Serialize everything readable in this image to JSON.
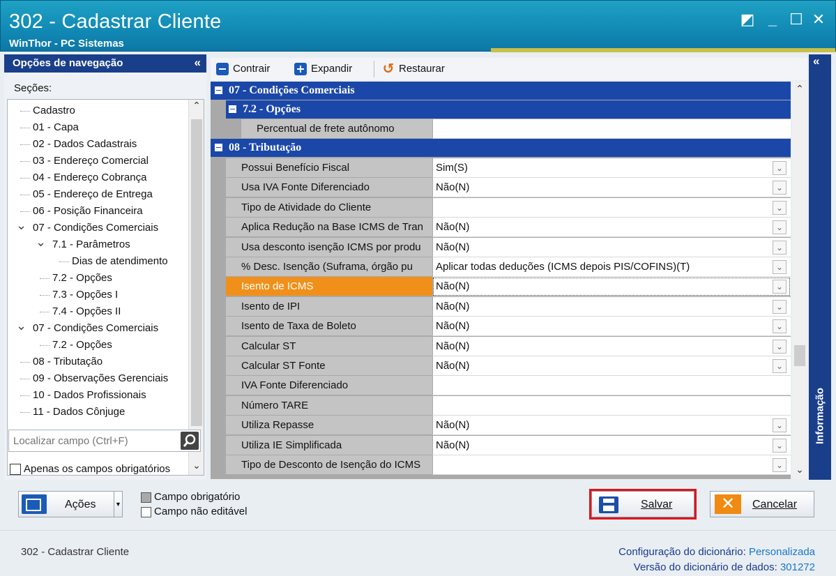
{
  "window": {
    "title": "302 - Cadastrar Cliente",
    "subtitle": "WinThor - PC Sistemas"
  },
  "nav": {
    "header": "Opções de navegação",
    "collapse": "«",
    "sections_label": "Seções:",
    "items": [
      {
        "label": "Cadastro",
        "level": 0,
        "expander": ""
      },
      {
        "label": "01 - Capa",
        "level": 0,
        "expander": ""
      },
      {
        "label": "02 - Dados Cadastrais",
        "level": 0,
        "expander": ""
      },
      {
        "label": "03 - Endereço Comercial",
        "level": 0,
        "expander": ""
      },
      {
        "label": "04 - Endereço Cobrança",
        "level": 0,
        "expander": ""
      },
      {
        "label": "05 - Endereço de Entrega",
        "level": 0,
        "expander": ""
      },
      {
        "label": "06 - Posição Financeira",
        "level": 0,
        "expander": ""
      },
      {
        "label": "07 - Condições Comerciais",
        "level": 0,
        "expander": "v"
      },
      {
        "label": "7.1 - Parâmetros",
        "level": 1,
        "expander": "v"
      },
      {
        "label": "Dias de atendimento",
        "level": 2,
        "expander": ""
      },
      {
        "label": "7.2 - Opções",
        "level": 1,
        "expander": ""
      },
      {
        "label": "7.3 - Opções I",
        "level": 1,
        "expander": ""
      },
      {
        "label": "7.4 - Opções II",
        "level": 1,
        "expander": ""
      },
      {
        "label": "07 - Condições Comerciais",
        "level": 0,
        "expander": "v"
      },
      {
        "label": "7.2 - Opções",
        "level": 1,
        "expander": ""
      },
      {
        "label": "08 - Tributação",
        "level": 0,
        "expander": ""
      },
      {
        "label": "09 - Observações Gerenciais",
        "level": 0,
        "expander": ""
      },
      {
        "label": "10 - Dados Profissionais",
        "level": 0,
        "expander": ""
      },
      {
        "label": "11 - Dados Cônjuge",
        "level": 0,
        "expander": ""
      }
    ],
    "search_placeholder": "Localizar campo (Ctrl+F)",
    "required_only": "Apenas os campos obrigatórios"
  },
  "toolbar": {
    "contrair": "Contrair",
    "expandir": "Expandir",
    "restaurar": "Restaurar"
  },
  "grid": {
    "cat1": "07 - Condições Comerciais",
    "subcat1": "7.2 - Opções",
    "frete_label": "Percentual de frete autônomo",
    "frete_value": "",
    "cat2": "08 - Tributação",
    "rows": [
      {
        "name": "Possui Benefício Fiscal",
        "value": "Sim(S)",
        "dropdown": true
      },
      {
        "name": "Usa IVA Fonte Diferenciado",
        "value": "Não(N)",
        "dropdown": true
      },
      {
        "name": "Tipo de Atividade do Cliente",
        "value": "",
        "dropdown": true
      },
      {
        "name": "Aplica Redução na Base ICMS de Tran",
        "value": "Não(N)",
        "dropdown": true
      },
      {
        "name": "Usa desconto isenção ICMS por produ",
        "value": "Não(N)",
        "dropdown": true
      },
      {
        "name": "% Desc. Isenção (Suframa, órgão pu",
        "value": "Aplicar todas deduções (ICMS depois PIS/COFINS)(T)",
        "dropdown": true
      },
      {
        "name": "Isento de ICMS",
        "value": "Não(N)",
        "dropdown": true
      },
      {
        "name": "Isento de IPI",
        "value": "Não(N)",
        "dropdown": true
      },
      {
        "name": "Isento de Taxa de Boleto",
        "value": "Não(N)",
        "dropdown": true
      },
      {
        "name": "Calcular ST",
        "value": "Não(N)",
        "dropdown": true
      },
      {
        "name": "Calcular ST Fonte",
        "value": "Não(N)",
        "dropdown": true
      },
      {
        "name": "IVA Fonte Diferenciado",
        "value": "",
        "dropdown": false
      },
      {
        "name": "Número TARE",
        "value": "",
        "dropdown": false
      },
      {
        "name": "Utiliza Repasse",
        "value": "Não(N)",
        "dropdown": true
      },
      {
        "name": "Utiliza IE Simplificada",
        "value": "Não(N)",
        "dropdown": true
      },
      {
        "name": "Tipo de Desconto de Isenção do ICMS",
        "value": "",
        "dropdown": true
      }
    ],
    "selected_index": 6
  },
  "info_panel": {
    "label": "Informação",
    "collapse": "«"
  },
  "bottom": {
    "acoes": "Ações",
    "legend_required": "Campo obrigatório",
    "legend_readonly": "Campo não editável",
    "salvar": "Salvar",
    "cancelar": "Cancelar"
  },
  "status": {
    "left": "302 - Cadastrar Cliente",
    "config_label": "Configuração do dicionário:",
    "config_value": "Personalizada",
    "version_label": "Versão do dicionário de dados:",
    "version_value": "301272"
  },
  "colors": {
    "titlebar": "#1189b4",
    "nav_header": "#1a3f8a",
    "category": "#1a47a8",
    "selected_row": "#f0901a",
    "highlight_border": "#e0141a",
    "cancel_icon": "#f08a12"
  }
}
